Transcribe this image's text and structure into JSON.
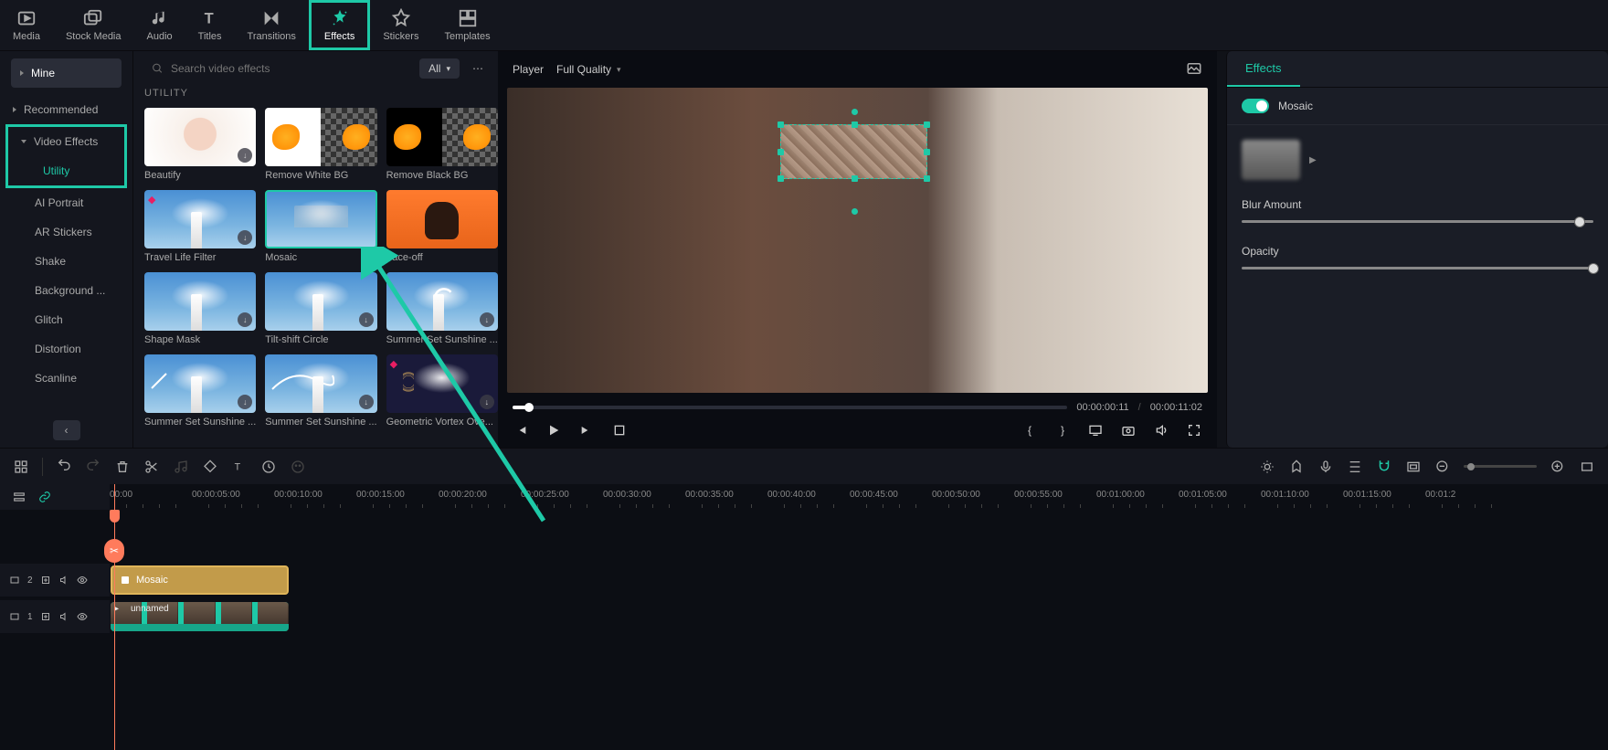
{
  "topTabs": {
    "media": "Media",
    "stockMedia": "Stock Media",
    "audio": "Audio",
    "titles": "Titles",
    "transitions": "Transitions",
    "effects": "Effects",
    "stickers": "Stickers",
    "templates": "Templates"
  },
  "leftCats": {
    "mine": "Mine",
    "recommended": "Recommended",
    "videoEffects": "Video Effects",
    "utility": "Utility",
    "aiPortrait": "AI Portrait",
    "arStickers": "AR Stickers",
    "shake": "Shake",
    "background": "Background ...",
    "glitch": "Glitch",
    "distortion": "Distortion",
    "scanline": "Scanline"
  },
  "search": {
    "placeholder": "Search video effects"
  },
  "filter": {
    "label": "All"
  },
  "sectionTitle": "UTILITY",
  "effects": {
    "beautify": "Beautify",
    "removeWhite": "Remove White BG",
    "removeBlack": "Remove Black BG",
    "travelLife": "Travel Life Filter",
    "mosaic": "Mosaic",
    "faceoff": "Face-off",
    "shapeMask": "Shape Mask",
    "tiltShift": "Tilt-shift Circle",
    "summerSun1": "Summer Set Sunshine ...",
    "summerSun2": "Summer Set Sunshine ...",
    "summerSun3": "Summer Set Sunshine ...",
    "geoVortex": "Geometric Vortex Ove..."
  },
  "player": {
    "label": "Player",
    "quality": "Full Quality",
    "currentTime": "00:00:00:11",
    "totalTime": "00:00:11:02"
  },
  "rightPanel": {
    "tab": "Effects",
    "effectName": "Mosaic",
    "blurAmount": "Blur Amount",
    "opacity": "Opacity",
    "blurValue": 100,
    "opacityValue": 100
  },
  "timeline": {
    "marks": [
      "00:00",
      "00:00:05:00",
      "00:00:10:00",
      "00:00:15:00",
      "00:00:20:00",
      "00:00:25:00",
      "00:00:30:00",
      "00:00:35:00",
      "00:00:40:00",
      "00:00:45:00",
      "00:00:50:00",
      "00:00:55:00",
      "00:01:00:00",
      "00:01:05:00",
      "00:01:10:00",
      "00:01:15:00",
      "00:01:2"
    ],
    "effectClip": "Mosaic",
    "videoClip": "unnamed",
    "track2": "2",
    "track1": "1"
  },
  "colors": {
    "accent": "#1ec9a7"
  }
}
